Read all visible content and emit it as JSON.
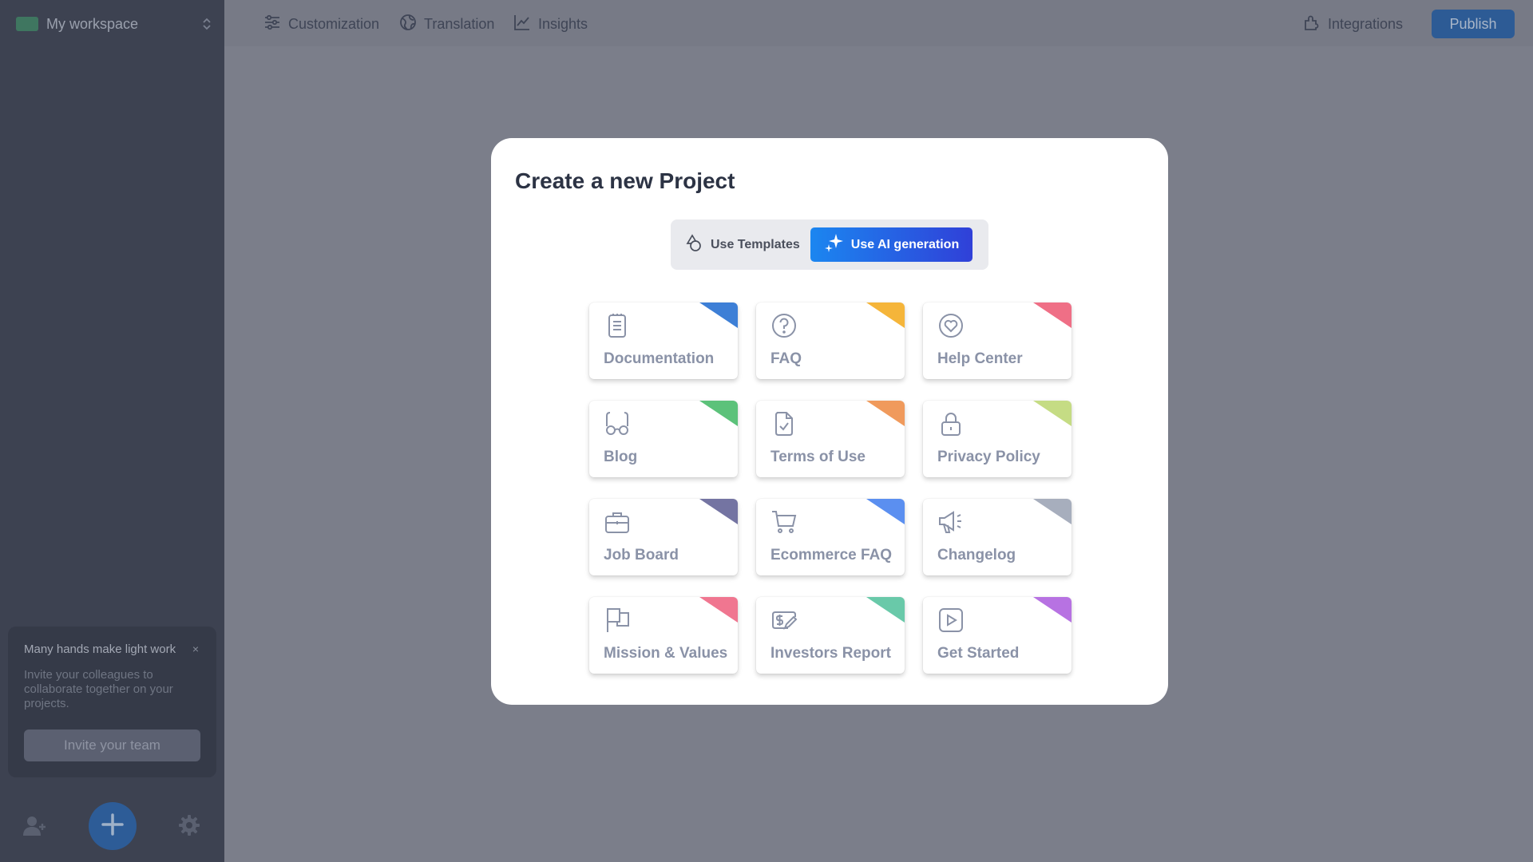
{
  "sidebar": {
    "workspace": {
      "name": "My workspace",
      "swatch_color": "#3f7660"
    },
    "promo": {
      "title": "Many hands make light work",
      "close": "×",
      "body": "Invite your colleagues to collaborate together on your projects.",
      "button": "Invite your team"
    },
    "bottom": {
      "icons": [
        "add-user-icon",
        "plus-icon",
        "gear-icon"
      ]
    }
  },
  "topbar": {
    "nav": [
      {
        "label": "Customization",
        "icon": "sliders-icon"
      },
      {
        "label": "Translation",
        "icon": "globe-icon"
      },
      {
        "label": "Insights",
        "icon": "chart-line-icon"
      }
    ],
    "integrations": "Integrations",
    "publish": "Publish"
  },
  "modal": {
    "title": "Create a new Project",
    "toggle": {
      "templates": "Use Templates",
      "ai": "Use AI generation",
      "selected": "ai"
    },
    "templates": [
      {
        "label": "Documentation",
        "icon": "document-list-icon",
        "color": "#3d7fd6"
      },
      {
        "label": "FAQ",
        "icon": "question-circle-icon",
        "color": "#f5b53a"
      },
      {
        "label": "Help Center",
        "icon": "heart-circle-icon",
        "color": "#ef6f86"
      },
      {
        "label": "Blog",
        "icon": "glasses-icon",
        "color": "#5cc27a"
      },
      {
        "label": "Terms of Use",
        "icon": "file-check-icon",
        "color": "#f09a5c"
      },
      {
        "label": "Privacy Policy",
        "icon": "lock-icon",
        "color": "#c5dc84"
      },
      {
        "label": "Job Board",
        "icon": "briefcase-icon",
        "color": "#7474a2"
      },
      {
        "label": "Ecommerce FAQ",
        "icon": "cart-icon",
        "color": "#5b8ff0"
      },
      {
        "label": "Changelog",
        "icon": "megaphone-icon",
        "color": "#a7aebd"
      },
      {
        "label": "Mission & Values",
        "icon": "flag-icon",
        "color": "#f07690"
      },
      {
        "label": "Investors Report",
        "icon": "money-pen-icon",
        "color": "#69c9a9"
      },
      {
        "label": "Get Started",
        "icon": "play-square-icon",
        "color": "#b772e2"
      }
    ]
  }
}
